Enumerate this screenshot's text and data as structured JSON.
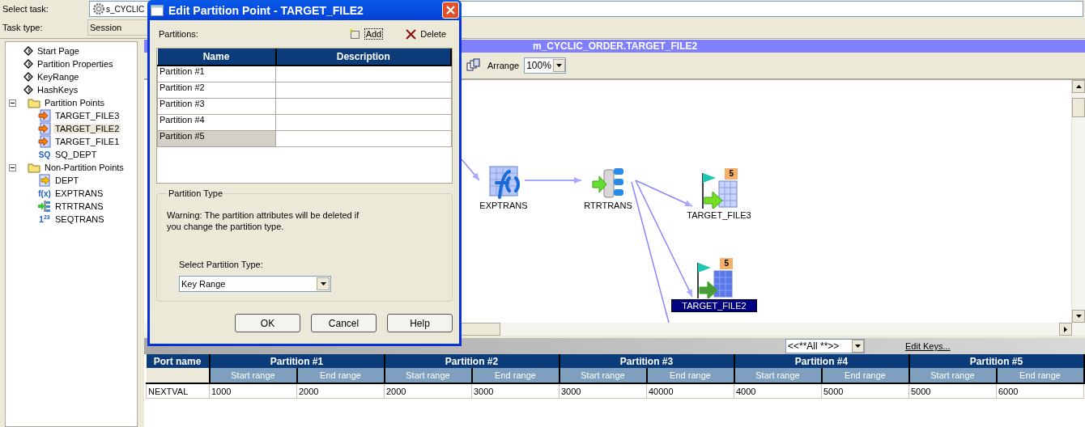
{
  "task_header": {
    "select_task_label": "Select task:",
    "select_task_value": "s_CYCLIC",
    "task_type_label": "Task type:",
    "task_type_value": "Session"
  },
  "tree": [
    {
      "label": "Start Page",
      "kind": "page",
      "selected": false
    },
    {
      "label": "Partition Properties",
      "kind": "page",
      "selected": false
    },
    {
      "label": "KeyRange",
      "kind": "page",
      "selected": false
    },
    {
      "label": "HashKeys",
      "kind": "page",
      "selected": false
    },
    {
      "label": "Partition Points",
      "kind": "folder",
      "expanded": true,
      "selected": false,
      "children": [
        {
          "label": "TARGET_FILE3",
          "kind": "target",
          "selected": false
        },
        {
          "label": "TARGET_FILE2",
          "kind": "target",
          "selected": true
        },
        {
          "label": "TARGET_FILE1",
          "kind": "target",
          "selected": false
        },
        {
          "label": "SQ_DEPT",
          "kind": "glyph",
          "icon_text": "SQ",
          "selected": false
        }
      ]
    },
    {
      "label": "Non-Partition Points",
      "kind": "folder",
      "expanded": true,
      "selected": false,
      "children": [
        {
          "label": "DEPT",
          "kind": "source",
          "selected": false
        },
        {
          "label": "EXPTRANS",
          "kind": "glyph",
          "icon_text": "f(x)",
          "selected": false
        },
        {
          "label": "RTRTRANS",
          "kind": "router",
          "selected": false
        },
        {
          "label": "SEQTRANS",
          "kind": "glyph",
          "icon_text": "1$^{23}$",
          "selected": false
        }
      ]
    }
  ],
  "mapping": {
    "title": "m_CYCLIC_ORDER.TARGET_FILE2",
    "arrange_button": "Arrange",
    "zoom": "100%",
    "nodes": [
      {
        "label": "EXPTRANS",
        "kind": "expression",
        "selected": false
      },
      {
        "label": "RTRTRANS",
        "kind": "router",
        "selected": false
      },
      {
        "label": "TARGET_FILE3",
        "kind": "target",
        "badge": "5",
        "selected": false
      },
      {
        "label": "TARGET_FILE2",
        "kind": "target",
        "badge": "5",
        "selected": true
      }
    ]
  },
  "key_range": {
    "filter": "<<**All **>>",
    "edit_keys_link": "Edit Keys...",
    "port_column": "Port name",
    "partitions": [
      {
        "name": "Partition #1",
        "start_label": "Start range",
        "end_label": "End range"
      },
      {
        "name": "Partition #2",
        "start_label": "Start range",
        "end_label": "End range"
      },
      {
        "name": "Partition #3",
        "start_label": "Start range",
        "end_label": "End range"
      },
      {
        "name": "Partition #4",
        "start_label": "Start range",
        "end_label": "End range"
      },
      {
        "name": "Partition #5",
        "start_label": "Start range",
        "end_label": "End range"
      }
    ],
    "rows": [
      {
        "port": "NEXTVAL",
        "ranges": [
          [
            "1000",
            "2000"
          ],
          [
            "2000",
            "3000"
          ],
          [
            "3000",
            "40000"
          ],
          [
            "4000",
            "5000"
          ],
          [
            "5000",
            "6000"
          ]
        ]
      }
    ]
  },
  "dialog": {
    "title": "Edit Partition Point - TARGET_FILE2",
    "partitions_label": "Partitions:",
    "add_button": "Add",
    "delete_button": "Delete",
    "columns": [
      "Name",
      "Description"
    ],
    "rows": [
      {
        "name": "Partition #1",
        "selected": false
      },
      {
        "name": "Partition #2",
        "selected": false
      },
      {
        "name": "Partition #3",
        "selected": false
      },
      {
        "name": "Partition #4",
        "selected": false
      },
      {
        "name": "Partition #5",
        "selected": true
      }
    ],
    "group_title": "Partition Type",
    "warning": "Warning: The partition attributes will be deleted if you change the partition type.",
    "type_label": "Select Partition Type:",
    "partition_type": "Key Range",
    "buttons": [
      "OK",
      "Cancel",
      "Help"
    ]
  }
}
